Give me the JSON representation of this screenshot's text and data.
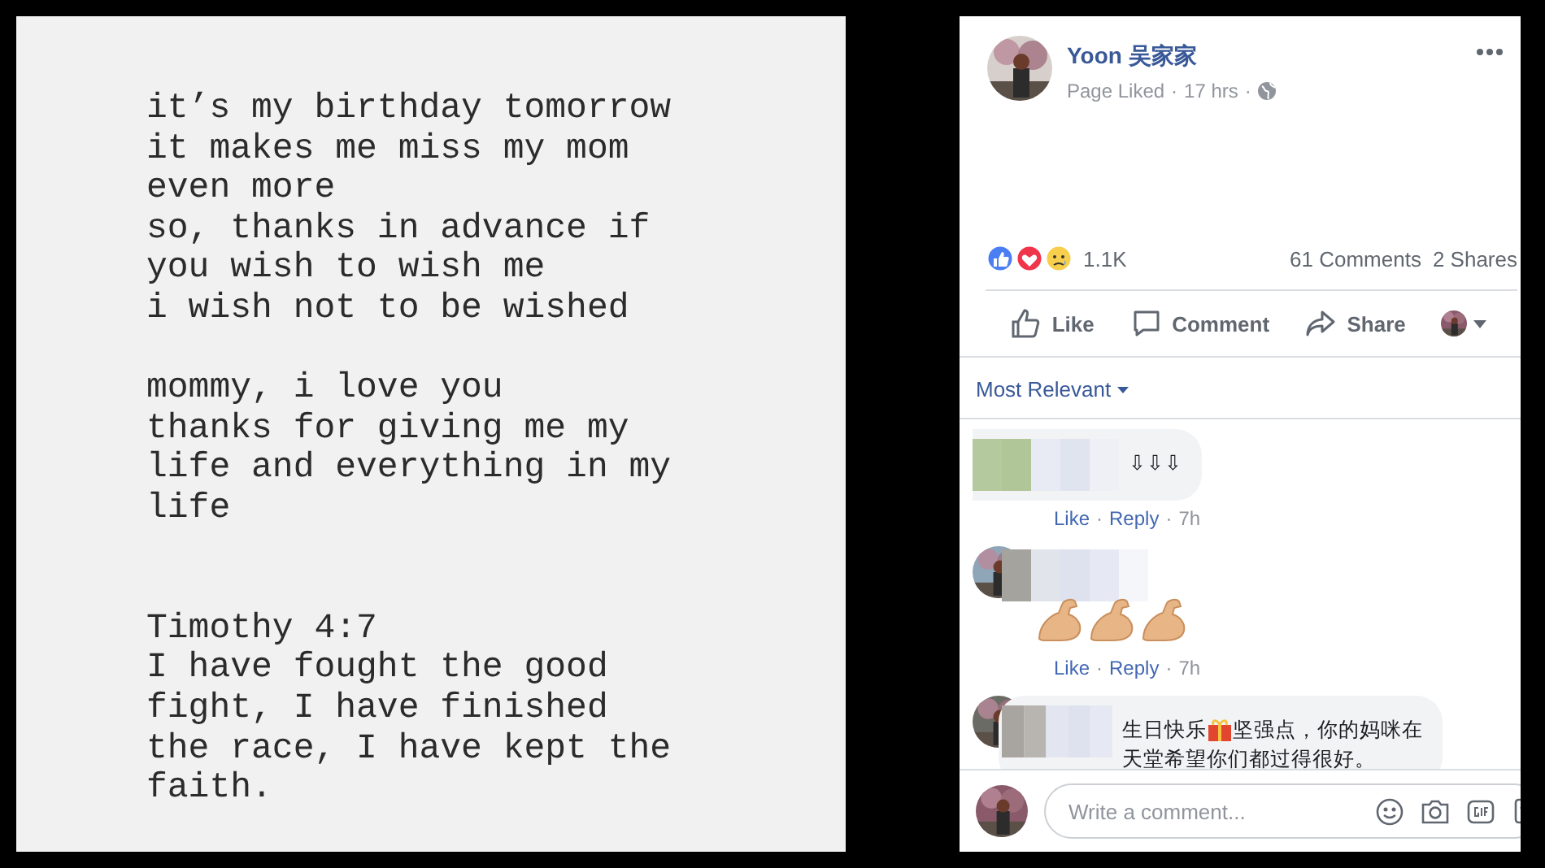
{
  "image_post": {
    "stanzas": [
      {
        "lines": [
          "it’s my birthday tomorrow",
          "it makes me miss my mom",
          "even more",
          "so, thanks in advance if",
          "you wish to wish me",
          "i wish not to be wished"
        ]
      },
      {
        "lines": [
          "mommy, i love you",
          "thanks for giving me my",
          "life and everything in my",
          "life"
        ]
      },
      {
        "lines": [
          "Timothy 4:7",
          "I have fought the good",
          "fight, I have finished",
          "the race, I have kept the",
          "faith."
        ]
      }
    ]
  },
  "post": {
    "author": "Yoon 吴家家",
    "meta": [
      "Page Liked",
      "·",
      "17 hrs",
      "·"
    ],
    "reactions": {
      "icons": [
        {
          "kind": "like"
        },
        {
          "kind": "love"
        },
        {
          "kind": "sad"
        }
      ],
      "count": "1.1K"
    },
    "comments_count": "61 Comments",
    "shares_count": "2 Shares",
    "actions": [
      {
        "kind": "like",
        "label": "Like"
      },
      {
        "kind": "comment",
        "label": "Comment"
      },
      {
        "kind": "share",
        "label": "Share"
      }
    ],
    "sort": "Most Relevant",
    "comments": [
      {
        "kind": "text",
        "lines": [
          [
            {
              "kind": "text",
              "text": "⇩⇩⇩"
            }
          ]
        ],
        "footer": [
          {
            "kind": "link",
            "text": "Like"
          },
          {
            "kind": "dot",
            "text": "·"
          },
          {
            "kind": "link",
            "text": "Reply"
          },
          {
            "kind": "dot",
            "text": "·"
          },
          {
            "kind": "time",
            "text": "7h"
          }
        ]
      },
      {
        "kind": "icons",
        "icons": [
          {
            "kind": "muscle"
          },
          {
            "kind": "muscle"
          },
          {
            "kind": "muscle"
          }
        ],
        "footer": [
          {
            "kind": "link",
            "text": "Like"
          },
          {
            "kind": "dot",
            "text": "·"
          },
          {
            "kind": "link",
            "text": "Reply"
          },
          {
            "kind": "dot",
            "text": "·"
          },
          {
            "kind": "time",
            "text": "7h"
          }
        ]
      },
      {
        "kind": "text",
        "lines": [
          [
            {
              "kind": "text",
              "text": "生日快乐"
            },
            {
              "kind": "gift"
            },
            {
              "kind": "text",
              "text": "坚强点，你的妈咪在"
            }
          ],
          [
            {
              "kind": "text",
              "text": "天堂希望你们都过得很好。"
            }
          ]
        ]
      }
    ],
    "composer": {
      "placeholder": "Write a comment..."
    }
  }
}
